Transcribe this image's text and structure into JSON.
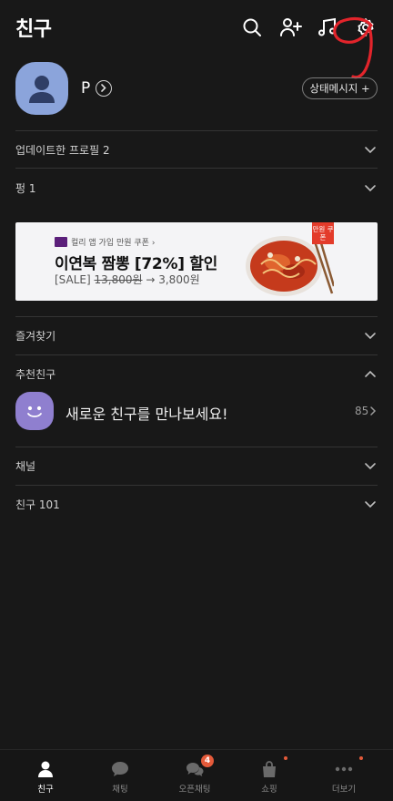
{
  "header": {
    "title": "친구",
    "icons": [
      "search-icon",
      "add-friend-icon",
      "music-icon",
      "settings-icon"
    ]
  },
  "profile": {
    "name": "P",
    "status_button": "상태메시지 +"
  },
  "sections": {
    "updated_profiles": "업데이트한 프로필 2",
    "pyeong": "펑 1",
    "favorites": "즐겨찾기",
    "recommended": "추천친구",
    "channels": "채널",
    "friends": "친구 101"
  },
  "ad": {
    "small_text": "컬리 앱 가입 만원 쿠폰 ›",
    "headline": "이연복 짬뽕 [72%] 할인",
    "price_prefix": "[SALE]",
    "original_price": "13,800원",
    "arrow_and_price": " → 3,800원",
    "coupon_label": "만원 쿠폰"
  },
  "recommended_item": {
    "text": "새로운 친구를 만나보세요!",
    "count": "85"
  },
  "tabs": [
    {
      "label": "친구",
      "icon": "person-icon",
      "active": true
    },
    {
      "label": "채팅",
      "icon": "chat-bubble-icon",
      "active": false
    },
    {
      "label": "오픈채팅",
      "icon": "open-chat-icon",
      "active": false,
      "badge": "4"
    },
    {
      "label": "쇼핑",
      "icon": "shopping-bag-icon",
      "active": false
    },
    {
      "label": "더보기",
      "icon": "more-dots-icon",
      "active": false
    }
  ],
  "colors": {
    "background": "#181818",
    "accent_badge": "#e45a3a",
    "annotation": "#e3242b",
    "avatar": "#8ba4db"
  }
}
